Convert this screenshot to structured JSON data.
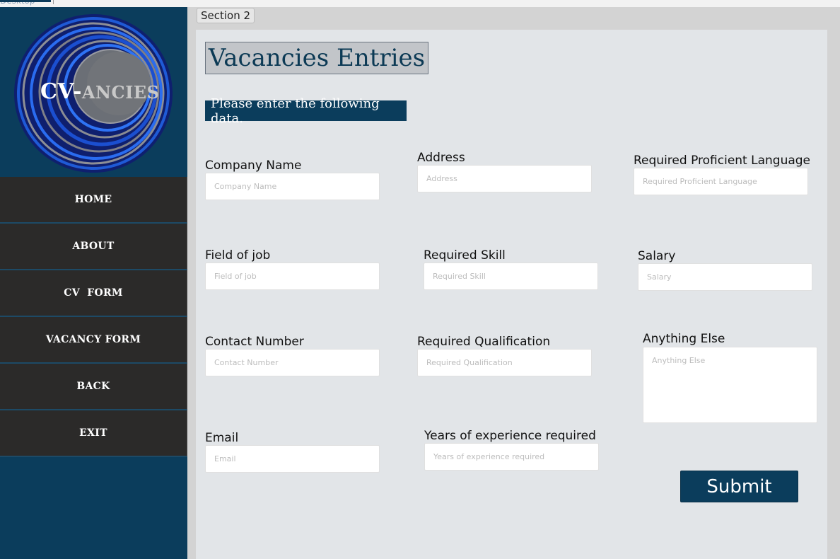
{
  "window": {
    "top_fragment": "Desktop"
  },
  "brand": {
    "logo_main": "CV-",
    "logo_rest": "ANCIES"
  },
  "nav": {
    "home": "HOME",
    "about": "ABOUT",
    "cv_form": "CV  FORM",
    "vacancy_form": "VACANCY FORM",
    "back": "BACK",
    "exit": "EXIT"
  },
  "section_tab": "Section 2",
  "page": {
    "title": "Vacancies Entries",
    "notice": "Please enter the following data."
  },
  "fields": {
    "company_name": {
      "label": "Company Name",
      "placeholder": "Company Name",
      "value": ""
    },
    "address": {
      "label": "Address",
      "placeholder": "Address",
      "value": ""
    },
    "language": {
      "label": "Required Proficient Language",
      "placeholder": "Required Proficient Language",
      "value": ""
    },
    "field_of_job": {
      "label": "Field of job",
      "placeholder": "Field of job",
      "value": ""
    },
    "skill": {
      "label": "Required Skill",
      "placeholder": "Required Skill",
      "value": ""
    },
    "salary": {
      "label": "Salary",
      "placeholder": "Salary",
      "value": ""
    },
    "contact": {
      "label": "Contact Number",
      "placeholder": "Contact Number",
      "value": ""
    },
    "qualification": {
      "label": "Required Qualification",
      "placeholder": "Required Qualification",
      "value": ""
    },
    "anything_else": {
      "label": "Anything Else",
      "placeholder": "Anything Else",
      "value": ""
    },
    "email": {
      "label": "Email",
      "placeholder": "Email",
      "value": ""
    },
    "experience": {
      "label": "Years of experience required",
      "placeholder": "Years of experience required",
      "value": ""
    }
  },
  "submit_label": "Submit",
  "colors": {
    "brand_navy": "#0b3d5c",
    "nav_dark": "#2b2a29",
    "panel": "#e2e5e8"
  }
}
